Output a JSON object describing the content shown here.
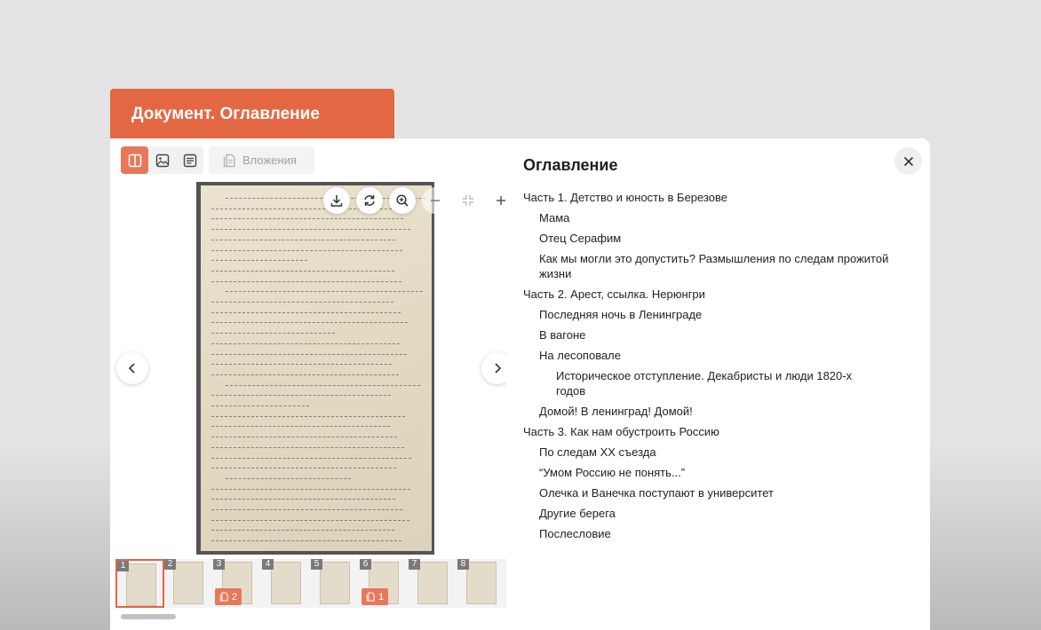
{
  "header": {
    "title": "Документ. Оглавление"
  },
  "toolbar": {
    "attachments_label": "Вложения"
  },
  "viewer": {
    "thumbnails": [
      {
        "num": "1",
        "active": true
      },
      {
        "num": "2"
      },
      {
        "num": "3",
        "attachments": "2"
      },
      {
        "num": "4"
      },
      {
        "num": "5"
      },
      {
        "num": "6",
        "attachments": "1"
      },
      {
        "num": "7"
      },
      {
        "num": "8"
      }
    ]
  },
  "toc": {
    "title": "Оглавление",
    "items": [
      {
        "label": "Часть 1. Детство и юность в Березове",
        "level": 0
      },
      {
        "label": "Мама",
        "level": 1
      },
      {
        "label": "Отец Серафим",
        "level": 1
      },
      {
        "label": "Как мы могли это допустить? Размышления по следам прожитой жизни",
        "level": 1
      },
      {
        "label": "Часть 2. Арест, ссылка. Нерюнгри",
        "level": 0
      },
      {
        "label": "Последняя ночь в Ленинграде",
        "level": 1
      },
      {
        "label": "В вагоне",
        "level": 1
      },
      {
        "label": "На лесоповале",
        "level": 1
      },
      {
        "label": "Историческое отступление. Декабристы и люди 1820-х годов",
        "level": 2
      },
      {
        "label": "Домой! В ленинград! Домой!",
        "level": 1
      },
      {
        "label": "Часть 3. Как нам обустроить Россию",
        "level": 0
      },
      {
        "label": "По следам XX съезда",
        "level": 1
      },
      {
        "label": "“Умом Россию не понять...”",
        "level": 1
      },
      {
        "label": "Олечка и Ванечка поступают в университет",
        "level": 1
      },
      {
        "label": "Другие берега",
        "level": 1
      },
      {
        "label": "Послесловие",
        "level": 1
      }
    ]
  },
  "icons": {
    "split_view": "split-view-icon",
    "image_view": "image-icon",
    "text_view": "text-icon",
    "attachments": "attachment-doc-icon",
    "download": "download-icon",
    "rotate": "rotate-icon",
    "zoom_in": "zoom-in-icon",
    "zoom_out": "minus-icon",
    "fit": "collapse-icon",
    "plus": "plus-icon",
    "prev": "chevron-left-icon",
    "next": "chevron-right-icon",
    "close": "close-icon"
  },
  "colors": {
    "accent": "#e46744"
  }
}
